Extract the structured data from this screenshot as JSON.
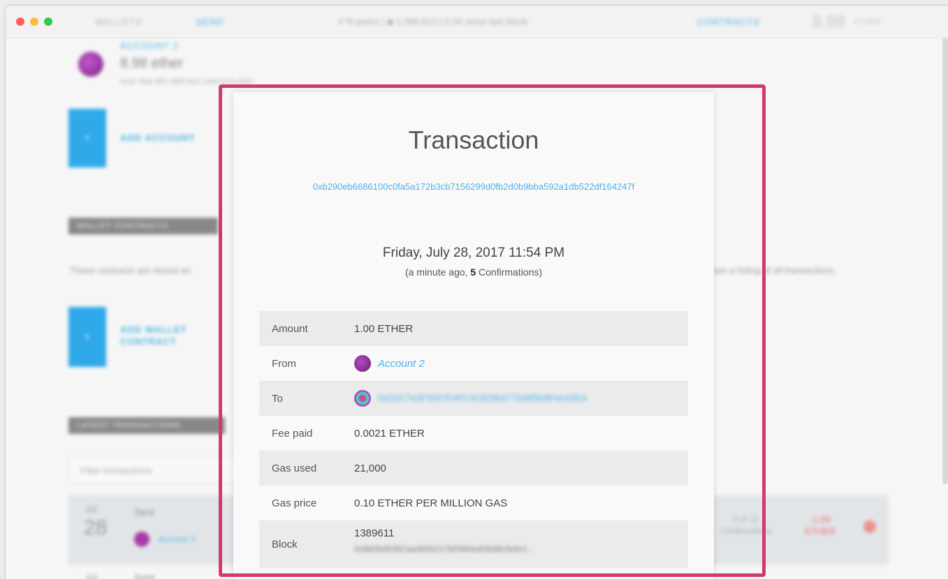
{
  "app": {
    "nav": {
      "wallets": "WALLETS",
      "send": "SEND",
      "info": "4 % peers  |  ◆ 1,389,613  |  0:34 since last block",
      "contracts": "CONTRACTS",
      "balance": "8.98",
      "balance_unit": "ETHER"
    }
  },
  "background": {
    "account_name": "ACCOUNT 2",
    "account_balance": "8.98 ether",
    "account_address": "0x1b 76d4 3f52 d6f8 9a21 c4e0 b37a 55e2",
    "add_account": "ADD ACCOUNT",
    "wallet_contracts_header": "WALLET CONTRACTS",
    "contracts_description_left": "These contracts are stored on",
    "contracts_description_right": "see a listing of all transactions.",
    "add_wallet_contract": "ADD WALLET CONTRACT",
    "latest_transactions_header": "LATEST TRANSACTIONS",
    "filter_placeholder": "Filter transactions",
    "tx": {
      "month": "Jul",
      "day": "28",
      "type": "Sent",
      "from": "Account 2",
      "confirmations": "5 of 12 Confirmations",
      "amount": "-1.00 ETHER",
      "month2": "Jul",
      "type2": "Sent"
    }
  },
  "modal": {
    "title": "Transaction",
    "hash": "0xb290eb6686100c0fa5a172b3cb7156299d0fb2d0b9bba592a1db522df164247f",
    "date": "Friday, July 28, 2017 11:54 PM",
    "ago_prefix": "(a minute ago, ",
    "confirmations": "5",
    "ago_suffix": " Confirmations)",
    "rows": {
      "amount_label": "Amount",
      "amount_value": "1.00 ETHER",
      "from_label": "From",
      "from_value": "Account 2",
      "to_label": "To",
      "to_value": "0xD2C7e3F5047F4FC3C829b4773d9f5b9Fee43EA",
      "fee_label": "Fee paid",
      "fee_value": "0.0021 ETHER",
      "gas_used_label": "Gas used",
      "gas_used_value": "21,000",
      "gas_price_label": "Gas price",
      "gas_price_value": "0.10 ETHER PER MILLION GAS",
      "block_label": "Block",
      "block_value": "1389611",
      "block_hash": "0x8b05d538Caa4606217bf3464a93b88c5efe1..."
    }
  },
  "colors": {
    "accent": "#4cb2e6",
    "highlight": "#d23a6e",
    "tile_blue": "#2fa9ea"
  }
}
